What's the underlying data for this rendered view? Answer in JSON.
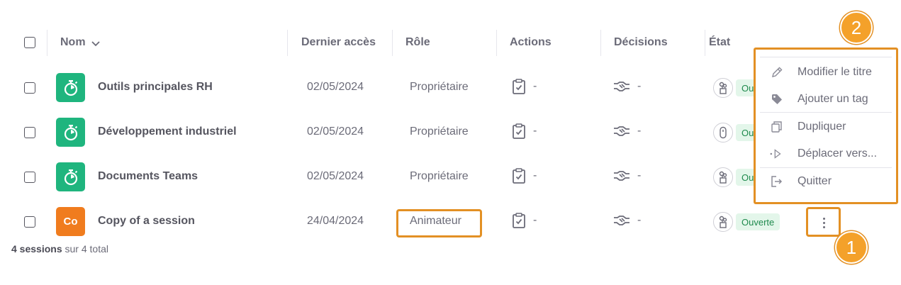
{
  "header": {
    "name": "Nom",
    "last_access": "Dernier accès",
    "role": "Rôle",
    "actions": "Actions",
    "decisions": "Décisions",
    "state": "État"
  },
  "rows": [
    {
      "icon": "stopwatch-icon",
      "name": "Outils principales RH",
      "date": "02/05/2024",
      "role": "Propriétaire",
      "actions": "-",
      "decisions": "-",
      "state_icon": "tree-icon",
      "state": "Ou"
    },
    {
      "icon": "stopwatch-icon",
      "name": "Développement industriel",
      "date": "02/05/2024",
      "role": "Propriétaire",
      "actions": "-",
      "decisions": "-",
      "state_icon": "capsule-icon",
      "state": "Ou"
    },
    {
      "icon": "stopwatch-icon",
      "name": "Documents Teams",
      "date": "02/05/2024",
      "role": "Propriétaire",
      "actions": "-",
      "decisions": "-",
      "state_icon": "tree-icon",
      "state": "Ou"
    },
    {
      "icon_text": "Co",
      "name": "Copy of a session",
      "date": "24/04/2024",
      "role": "Animateur",
      "actions": "-",
      "decisions": "-",
      "state_icon": "tree-icon",
      "state": "Ouverte"
    }
  ],
  "footer": {
    "count": "4 sessions",
    "rest": "sur 4 total"
  },
  "menu": {
    "items": [
      {
        "label": "Modifier le titre",
        "icon": "pencil-icon"
      },
      {
        "label": "Ajouter un tag",
        "icon": "tag-icon"
      },
      {
        "label": "Dupliquer",
        "icon": "copy-icon"
      },
      {
        "label": "Déplacer vers...",
        "icon": "move-icon"
      },
      {
        "label": "Quitter",
        "icon": "exit-icon"
      }
    ]
  },
  "callouts": {
    "one": "1",
    "two": "2"
  },
  "colors": {
    "highlight": "#e39024",
    "callout": "#f4a12a",
    "green": "#1fb57e",
    "orange": "#f07c1e"
  }
}
